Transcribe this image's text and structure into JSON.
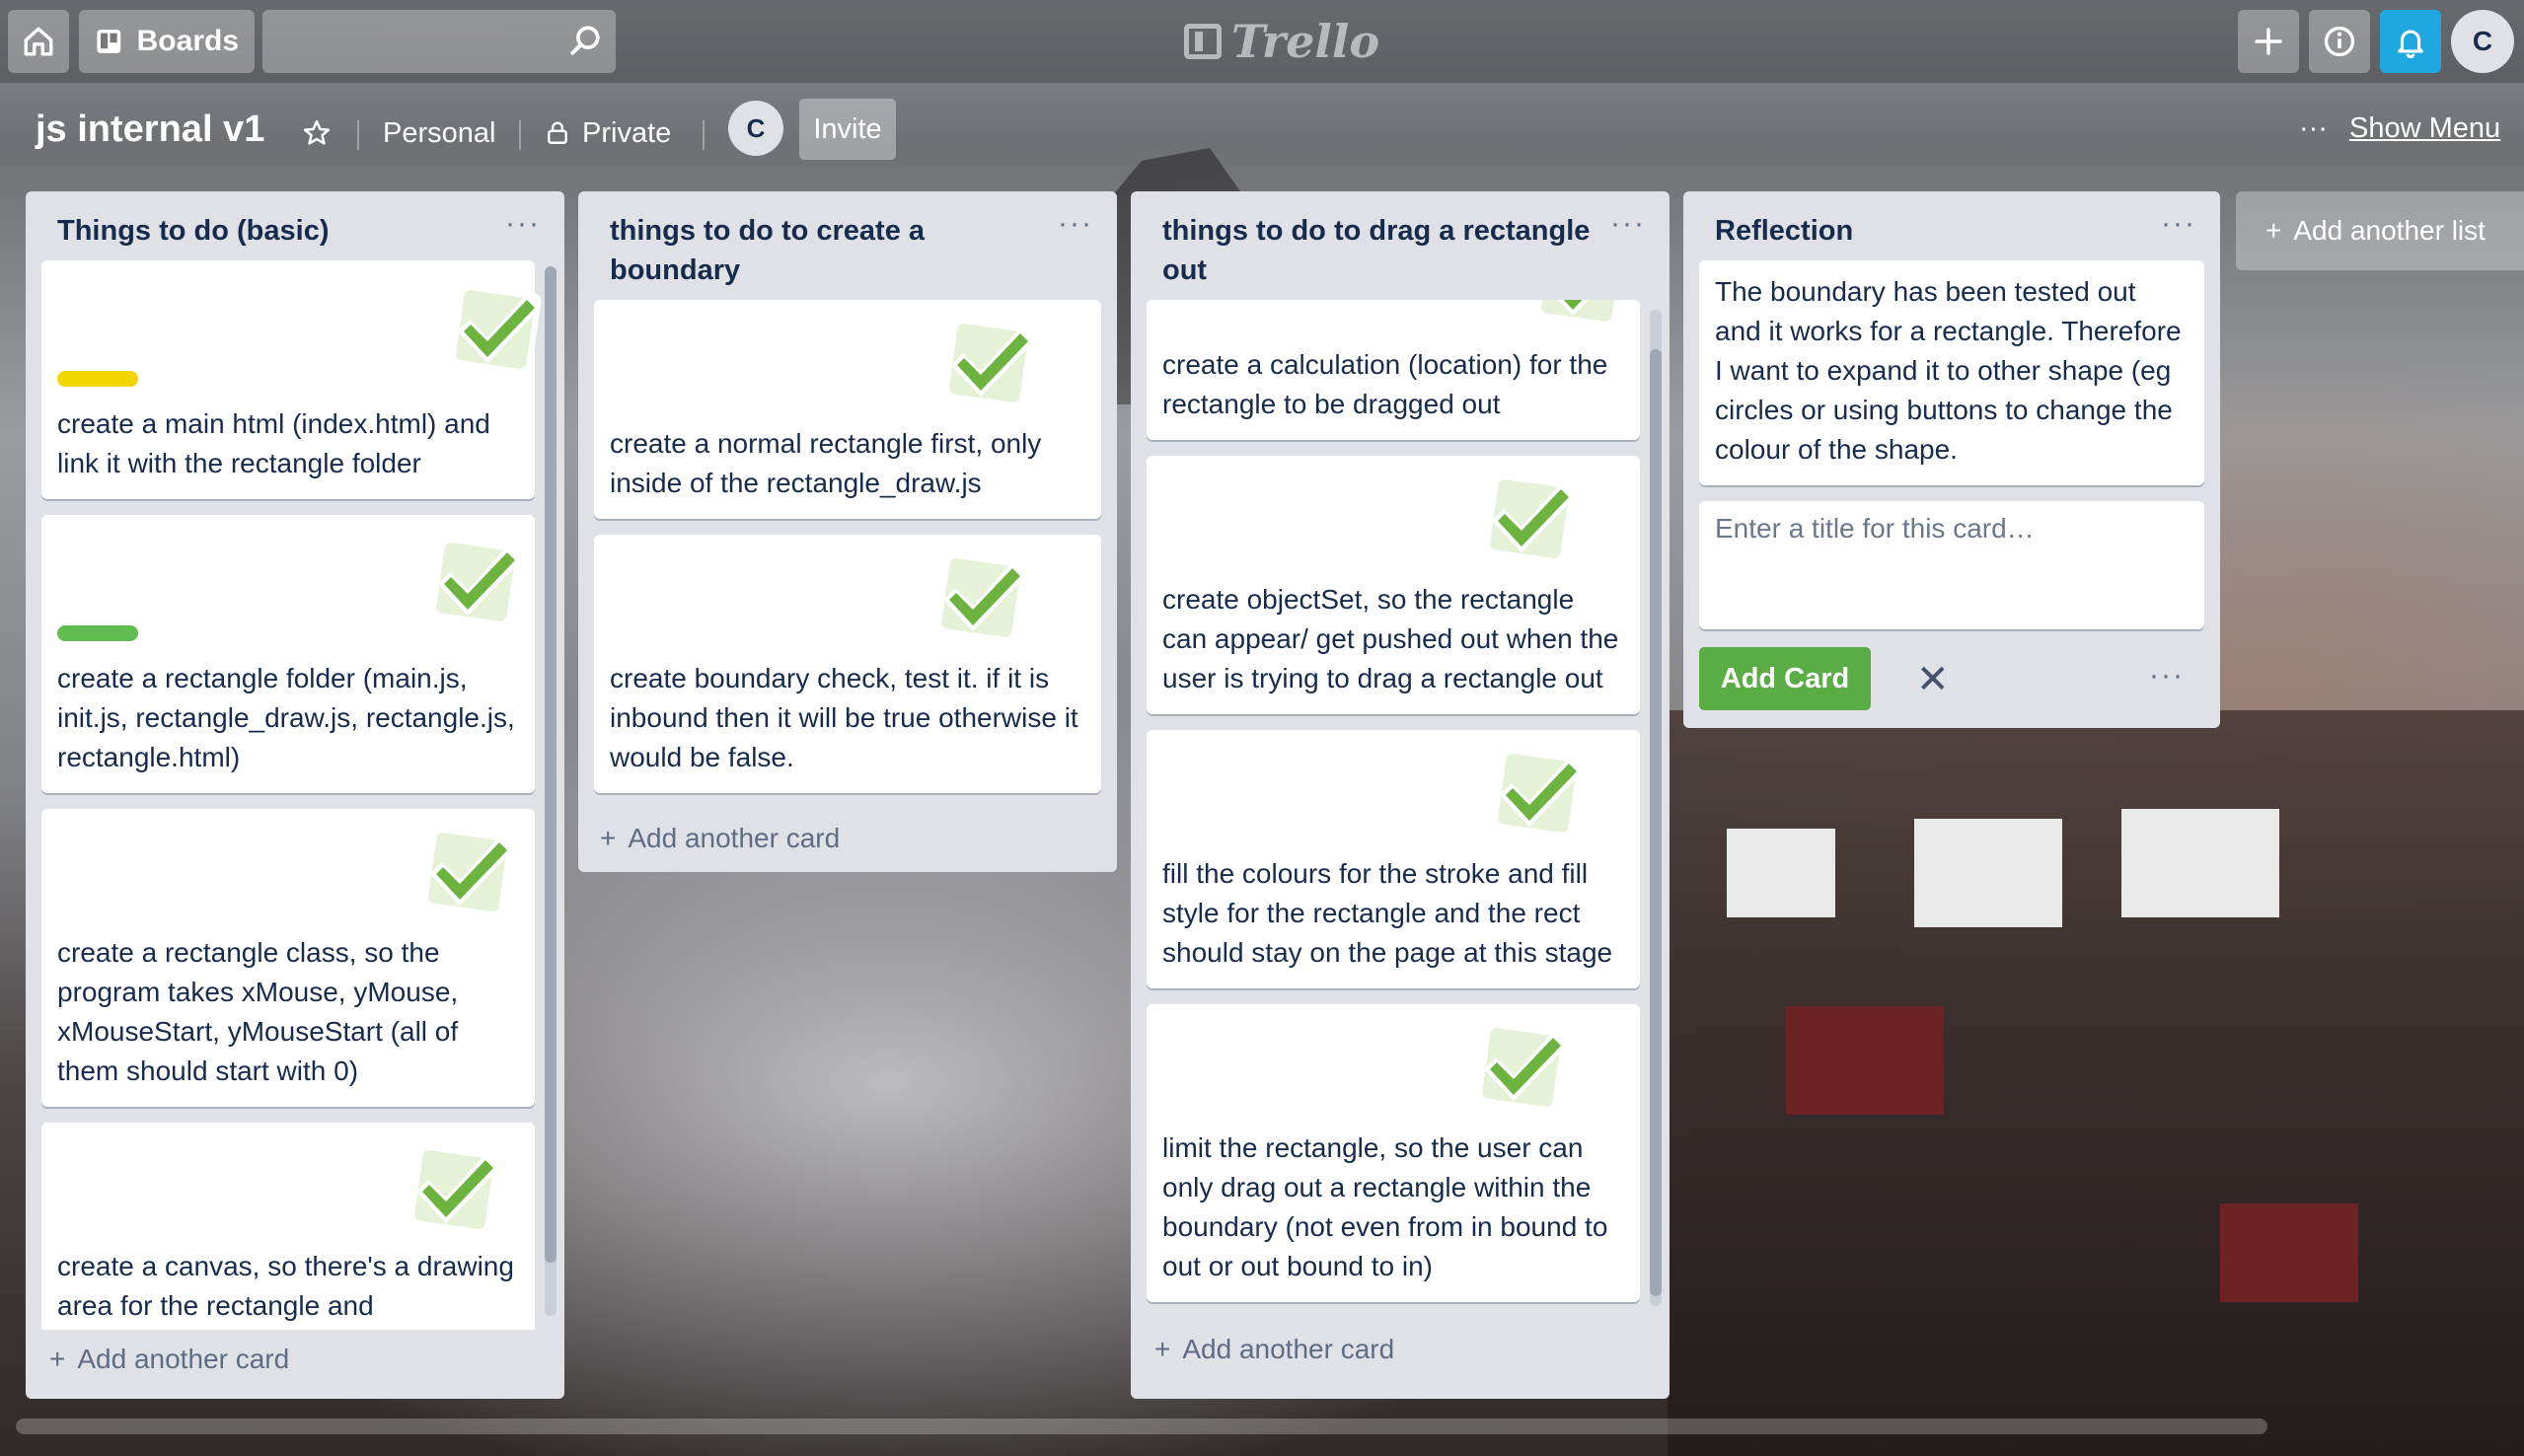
{
  "header": {
    "boards_label": "Boards",
    "search_value": "",
    "logo_text": "Trello",
    "user_initial": "C"
  },
  "board": {
    "title": "js internal v1",
    "team": "Personal",
    "visibility": "Private",
    "member_initial": "C",
    "invite_label": "Invite",
    "menu_dots": "···",
    "show_menu_label": "Show Menu"
  },
  "lists": [
    {
      "title": "Things to do (basic)",
      "menu": "···",
      "cards": [
        {
          "text": "create a main html (index.html) and link it with the rectangle folder",
          "label_color": "#f2d600",
          "done": true
        },
        {
          "text": "create a rectangle folder (main.js, init.js, rectangle_draw.js, rectangle.js, rectangle.html)",
          "label_color": "#61bd4f",
          "done": true
        },
        {
          "text": "create a rectangle class, so the program takes xMouse, yMouse, xMouseStart, yMouseStart (all of them should start with 0)",
          "label_color": "",
          "done": true
        },
        {
          "text": "create a canvas, so there's a drawing area for the rectangle and",
          "label_color": "",
          "done": true
        }
      ],
      "add_card": "Add another card"
    },
    {
      "title": "things to do to create a boundary",
      "menu": "···",
      "cards": [
        {
          "text": "create a normal rectangle first, only inside of the rectangle_draw.js",
          "done": true
        },
        {
          "text": "create boundary check, test it. if it is inbound then it will be true otherwise it would be false.",
          "done": true
        }
      ],
      "add_card": "Add another card"
    },
    {
      "title": "things to do to drag a rectangle out",
      "menu": "···",
      "cards": [
        {
          "text": "create a calculation (location) for the rectangle to be dragged out",
          "done": true
        },
        {
          "text": "create objectSet, so the rectangle can appear/ get pushed out when the user is trying to drag a rectangle out",
          "done": true
        },
        {
          "text": "fill the colours for the stroke and fill style for the rectangle and the rect should stay on the page at this stage",
          "done": true
        },
        {
          "text": "limit the rectangle, so the user can only drag out a rectangle within the boundary (not even from in bound to out or out bound to in)",
          "done": true
        }
      ],
      "add_card": "Add another card"
    },
    {
      "title": "Reflection",
      "menu": "···",
      "cards": [
        {
          "text": "The boundary has been tested out and it works for a rectangle. Therefore I want to expand it to other shape (eg circles or using buttons to change the colour of the shape."
        }
      ],
      "composer": {
        "placeholder": "Enter a title for this card…",
        "value": "",
        "add_button": "Add Card",
        "close": "✕",
        "more": "···"
      }
    }
  ],
  "add_list_label": "Add another list",
  "colors": {
    "add_button_green": "#5aac44",
    "notification_blue": "#1fa8e0",
    "list_background": "#dfe1e6",
    "check_green": "#6cb33f"
  }
}
